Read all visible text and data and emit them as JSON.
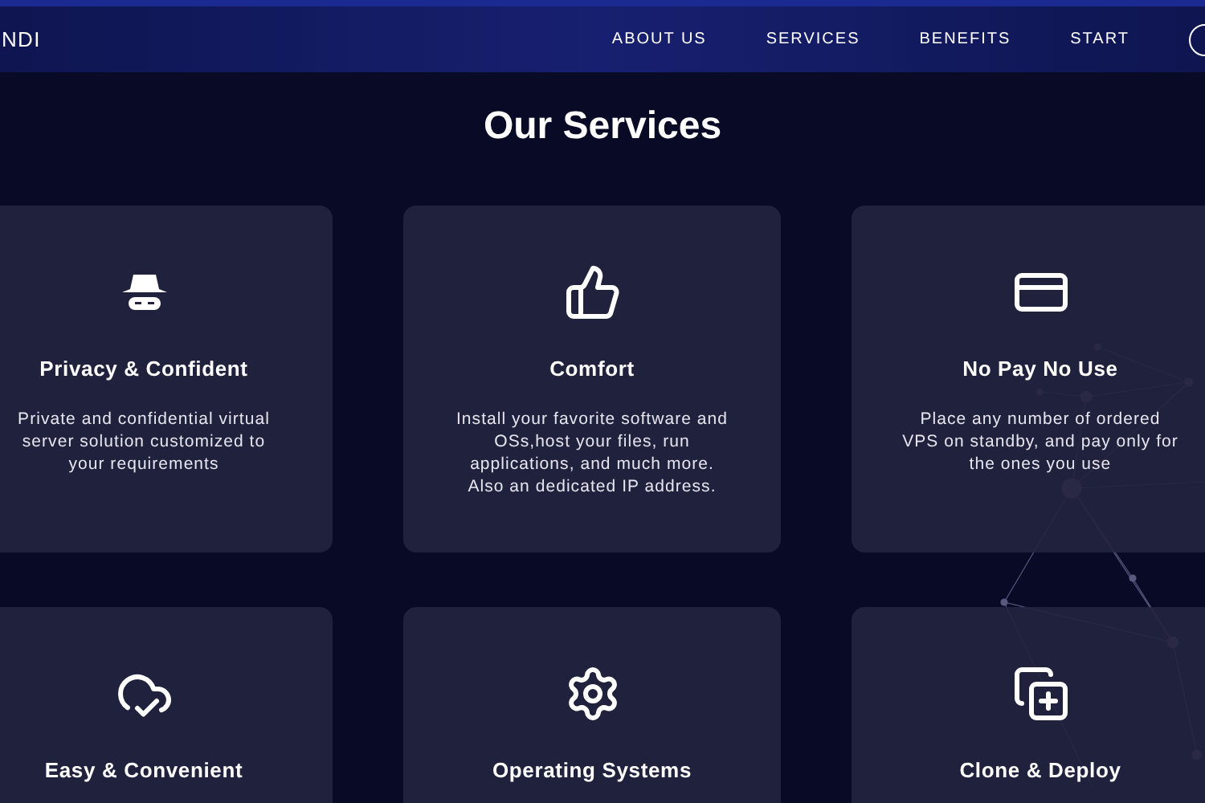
{
  "header": {
    "logo": "NDI",
    "nav": [
      {
        "label": "ABOUT US"
      },
      {
        "label": "SERVICES"
      },
      {
        "label": "BENEFITS"
      },
      {
        "label": "START"
      }
    ]
  },
  "title": "Our Services",
  "services": [
    {
      "title": "Privacy & Confident",
      "text": "Private and confidential virtual server solution customized to your requirements"
    },
    {
      "title": "Comfort",
      "text": "Install your favorite software and OSs,host your files, run applications, and much more. Also an dedicated IP address."
    },
    {
      "title": "No Pay No Use",
      "text": "Place any number of ordered VPS on standby, and pay only for the ones you use"
    },
    {
      "title": "Easy & Convenient"
    },
    {
      "title": "Operating Systems"
    },
    {
      "title": "Clone & Deploy"
    }
  ]
}
